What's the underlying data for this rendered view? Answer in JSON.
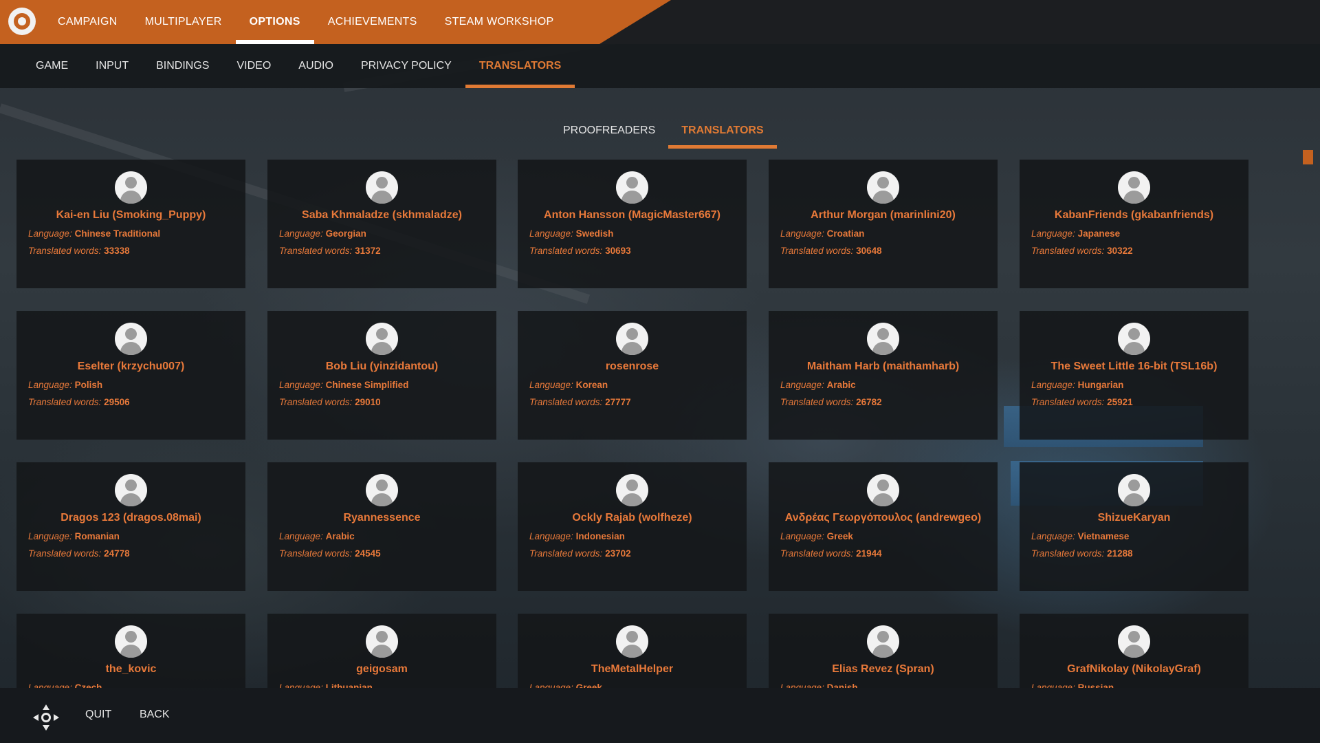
{
  "top_nav": {
    "items": [
      {
        "label": "CAMPAIGN",
        "active": false
      },
      {
        "label": "MULTIPLAYER",
        "active": false
      },
      {
        "label": "OPTIONS",
        "active": true
      },
      {
        "label": "ACHIEVEMENTS",
        "active": false
      },
      {
        "label": "STEAM WORKSHOP",
        "active": false
      }
    ]
  },
  "sub_nav": {
    "items": [
      {
        "label": "GAME",
        "active": false
      },
      {
        "label": "INPUT",
        "active": false
      },
      {
        "label": "BINDINGS",
        "active": false
      },
      {
        "label": "VIDEO",
        "active": false
      },
      {
        "label": "AUDIO",
        "active": false
      },
      {
        "label": "PRIVACY POLICY",
        "active": false
      },
      {
        "label": "TRANSLATORS",
        "active": true
      }
    ]
  },
  "inner_tabs": [
    {
      "label": "PROOFREADERS",
      "active": false
    },
    {
      "label": "TRANSLATORS",
      "active": true
    }
  ],
  "card_labels": {
    "language": "Language:",
    "words": "Translated words:"
  },
  "translators": [
    {
      "name": "Kai-en Liu (Smoking_Puppy)",
      "language": "Chinese Traditional",
      "words": "33338"
    },
    {
      "name": "Saba Khmaladze (skhmaladze)",
      "language": "Georgian",
      "words": "31372"
    },
    {
      "name": "Anton Hansson (MagicMaster667)",
      "language": "Swedish",
      "words": "30693"
    },
    {
      "name": "Arthur Morgan (marinlini20)",
      "language": "Croatian",
      "words": "30648"
    },
    {
      "name": "KabanFriends (gkabanfriends)",
      "language": "Japanese",
      "words": "30322"
    },
    {
      "name": "Eselter (krzychu007)",
      "language": "Polish",
      "words": "29506"
    },
    {
      "name": "Bob Liu (yinzidantou)",
      "language": "Chinese Simplified",
      "words": "29010"
    },
    {
      "name": "rosenrose",
      "language": "Korean",
      "words": "27777"
    },
    {
      "name": "Maitham Harb (maithamharb)",
      "language": "Arabic",
      "words": "26782"
    },
    {
      "name": "The Sweet Little 16-bit (TSL16b)",
      "language": "Hungarian",
      "words": "25921"
    },
    {
      "name": "Dragos 123 (dragos.08mai)",
      "language": "Romanian",
      "words": "24778"
    },
    {
      "name": "Ryannessence",
      "language": "Arabic",
      "words": "24545"
    },
    {
      "name": "Ockly Rajab (wolfheze)",
      "language": "Indonesian",
      "words": "23702"
    },
    {
      "name": "Ανδρέας Γεωργόπουλος (andrewgeo)",
      "language": "Greek",
      "words": "21944"
    },
    {
      "name": "ShizueKaryan",
      "language": "Vietnamese",
      "words": "21288"
    },
    {
      "name": "the_kovic",
      "language": "Czech",
      "words": ""
    },
    {
      "name": "geigosam",
      "language": "Lithuanian",
      "words": ""
    },
    {
      "name": "TheMetalHelper",
      "language": "Greek",
      "words": ""
    },
    {
      "name": "Elias Revez (Spran)",
      "language": "Danish",
      "words": ""
    },
    {
      "name": "GrafNikolay (NikolayGraf)",
      "language": "Russian",
      "words": ""
    }
  ],
  "bottom_bar": {
    "quit_label": "QUIT",
    "back_label": "BACK"
  },
  "colors": {
    "accent": "#c4611f",
    "text_accent": "#e8793a"
  }
}
